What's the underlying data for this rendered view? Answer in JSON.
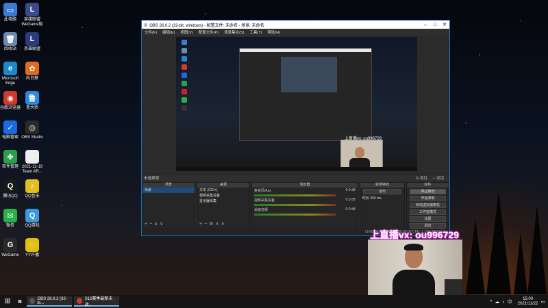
{
  "desktop": {
    "icons": [
      {
        "label": "此电脑",
        "color": "#3a7bd5",
        "glyph": "▭"
      },
      {
        "label": "英雄联盟WeGame版",
        "color": "#3a4a8a",
        "glyph": "L"
      },
      {
        "label": "回收站",
        "color": "#6a8ab0",
        "glyph": "🗑"
      },
      {
        "label": "英雄联盟",
        "color": "#2a3a7a",
        "glyph": "L"
      },
      {
        "label": "Microsoft Edge",
        "color": "#1e88c8",
        "glyph": "e"
      },
      {
        "label": "向日葵",
        "color": "#e06a20",
        "glyph": "✿"
      },
      {
        "label": "谷歌浏览器",
        "color": "#d0392b",
        "glyph": "◉"
      },
      {
        "label": "鲁大师",
        "color": "#2a8ae0",
        "glyph": "鲁"
      },
      {
        "label": "电脑管家",
        "color": "#1a6ae0",
        "glyph": "✓"
      },
      {
        "label": "OBS Studio",
        "color": "#2a2a2a",
        "glyph": "◎"
      },
      {
        "label": "软件管理",
        "color": "#2aa04a",
        "glyph": "✤"
      },
      {
        "label": "2021-11-19 Team AR...",
        "color": "#eeeeee",
        "glyph": "⁄"
      },
      {
        "label": "腾讯QQ",
        "color": "#1a1a1a",
        "glyph": "Q"
      },
      {
        "label": "QQ音乐",
        "color": "#e0c020",
        "glyph": "♪"
      },
      {
        "label": "微信",
        "color": "#2ab04a",
        "glyph": "✉"
      },
      {
        "label": "QQ游戏",
        "color": "#3a9ae0",
        "glyph": "Q"
      },
      {
        "label": "WeGame",
        "color": "#2a2a2a",
        "glyph": "G"
      },
      {
        "label": "YY开播",
        "color": "#e0c010",
        "glyph": "◌"
      }
    ]
  },
  "obs": {
    "title": "OBS 26.0.2 (32-bit, windows) - 配置文件: 未命名 - 场景: 未命名",
    "menu": [
      "文件(F)",
      "编辑(E)",
      "视图(V)",
      "配置文件(P)",
      "场景集合(S)",
      "工具(T)",
      "帮助(H)"
    ],
    "preview_label": "上直播vx: ou996729",
    "source_bar": {
      "label": "未选择源",
      "props": "属性",
      "filters": "滤镜"
    },
    "panels": {
      "scenes": {
        "title": "场景",
        "items": [
          "场景"
        ]
      },
      "sources": {
        "title": "来源",
        "items": [
          "文本 (GDI+)",
          "视频采集设备",
          "显示器采集"
        ]
      },
      "mixer": {
        "title": "混音器",
        "channels": [
          {
            "name": "麦克风/Aux",
            "db": "0.0 dB"
          },
          {
            "name": "视频采集设备",
            "db": "0.0 dB"
          },
          {
            "name": "桌面音频",
            "db": "0.0 dB"
          }
        ]
      },
      "transitions": {
        "title": "转场特效",
        "type": "淡出",
        "duration_label": "时长",
        "duration": "300 ms"
      },
      "controls": {
        "title": "控件",
        "buttons": [
          "停止推流",
          "开始录制",
          "启动虚拟摄像机",
          "工作室模式",
          "设置",
          "退出"
        ]
      }
    },
    "status": "LIVE: 00:00:00   REC: 00:00:00   CPU: 1.1%, 30.00 fps"
  },
  "overlay": {
    "cam_label": "上直播vx: ou996729"
  },
  "taskbar": {
    "items": [
      {
        "label": "OBS 26.0.2 (32-bi...",
        "color": "#555555"
      },
      {
        "label": "S12赛季最新未改...",
        "color": "#d0392b"
      }
    ],
    "tray_icons": [
      "^",
      "☁",
      "♪",
      "中"
    ],
    "time": "15:00",
    "date": "2021/11/22"
  }
}
